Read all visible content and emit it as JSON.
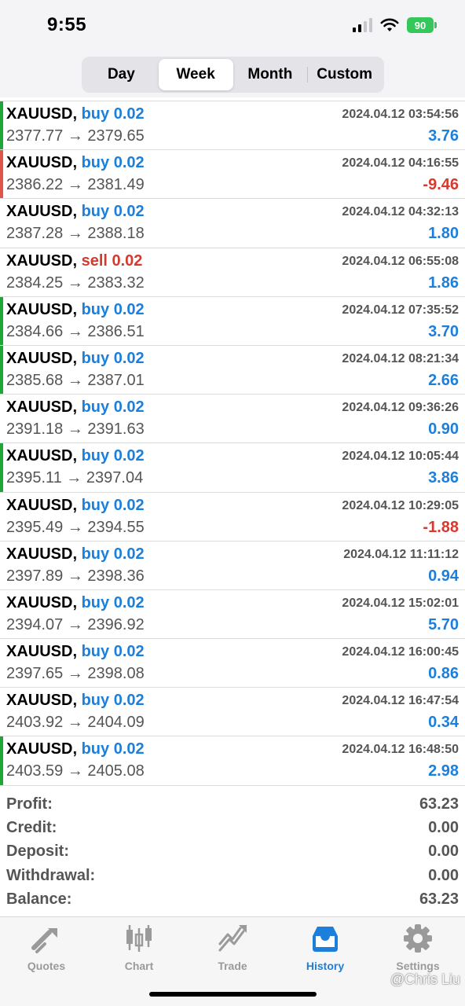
{
  "status_bar": {
    "time": "9:55",
    "battery": "90"
  },
  "period_tabs": [
    {
      "label": "Day",
      "active": false
    },
    {
      "label": "Week",
      "active": true
    },
    {
      "label": "Month",
      "active": false
    },
    {
      "label": "Custom",
      "active": false
    }
  ],
  "trades": [
    {
      "symbol": "XAUUSD,",
      "side": "buy 0.02",
      "type": "buy",
      "time": "2024.04.12 03:54:56",
      "prices": "2377.77 → 2379.65",
      "profit": "3.76",
      "marker": "#1fa637"
    },
    {
      "symbol": "XAUUSD,",
      "side": "buy 0.02",
      "type": "buy",
      "time": "2024.04.12 04:16:55",
      "prices": "2386.22 → 2381.49",
      "profit": "-9.46",
      "marker": "#e0554a"
    },
    {
      "symbol": "XAUUSD,",
      "side": "buy 0.02",
      "type": "buy",
      "time": "2024.04.12 04:32:13",
      "prices": "2387.28 → 2388.18",
      "profit": "1.80",
      "marker": ""
    },
    {
      "symbol": "XAUUSD,",
      "side": "sell 0.02",
      "type": "sell",
      "time": "2024.04.12 06:55:08",
      "prices": "2384.25 → 2383.32",
      "profit": "1.86",
      "marker": ""
    },
    {
      "symbol": "XAUUSD,",
      "side": "buy 0.02",
      "type": "buy",
      "time": "2024.04.12 07:35:52",
      "prices": "2384.66 → 2386.51",
      "profit": "3.70",
      "marker": "#1fa637"
    },
    {
      "symbol": "XAUUSD,",
      "side": "buy 0.02",
      "type": "buy",
      "time": "2024.04.12 08:21:34",
      "prices": "2385.68 → 2387.01",
      "profit": "2.66",
      "marker": "#1fa637"
    },
    {
      "symbol": "XAUUSD,",
      "side": "buy 0.02",
      "type": "buy",
      "time": "2024.04.12 09:36:26",
      "prices": "2391.18 → 2391.63",
      "profit": "0.90",
      "marker": ""
    },
    {
      "symbol": "XAUUSD,",
      "side": "buy 0.02",
      "type": "buy",
      "time": "2024.04.12 10:05:44",
      "prices": "2395.11 → 2397.04",
      "profit": "3.86",
      "marker": "#1fa637"
    },
    {
      "symbol": "XAUUSD,",
      "side": "buy 0.02",
      "type": "buy",
      "time": "2024.04.12 10:29:05",
      "prices": "2395.49 → 2394.55",
      "profit": "-1.88",
      "marker": ""
    },
    {
      "symbol": "XAUUSD,",
      "side": "buy 0.02",
      "type": "buy",
      "time": "2024.04.12 11:11:12",
      "prices": "2397.89 → 2398.36",
      "profit": "0.94",
      "marker": ""
    },
    {
      "symbol": "XAUUSD,",
      "side": "buy 0.02",
      "type": "buy",
      "time": "2024.04.12 15:02:01",
      "prices": "2394.07 → 2396.92",
      "profit": "5.70",
      "marker": ""
    },
    {
      "symbol": "XAUUSD,",
      "side": "buy 0.02",
      "type": "buy",
      "time": "2024.04.12 16:00:45",
      "prices": "2397.65 → 2398.08",
      "profit": "0.86",
      "marker": ""
    },
    {
      "symbol": "XAUUSD,",
      "side": "buy 0.02",
      "type": "buy",
      "time": "2024.04.12 16:47:54",
      "prices": "2403.92 → 2404.09",
      "profit": "0.34",
      "marker": ""
    },
    {
      "symbol": "XAUUSD,",
      "side": "buy 0.02",
      "type": "buy",
      "time": "2024.04.12 16:48:50",
      "prices": "2403.59 → 2405.08",
      "profit": "2.98",
      "marker": "#1fa637"
    }
  ],
  "summary": [
    {
      "label": "Profit:",
      "value": "63.23"
    },
    {
      "label": "Credit:",
      "value": "0.00"
    },
    {
      "label": "Deposit:",
      "value": "0.00"
    },
    {
      "label": "Withdrawal:",
      "value": "0.00"
    },
    {
      "label": "Balance:",
      "value": "63.23"
    }
  ],
  "tab_bar": [
    {
      "label": "Quotes",
      "icon": "quotes-icon",
      "active": false
    },
    {
      "label": "Chart",
      "icon": "chart-icon",
      "active": false
    },
    {
      "label": "Trade",
      "icon": "trade-icon",
      "active": false
    },
    {
      "label": "History",
      "icon": "history-icon",
      "active": true
    },
    {
      "label": "Settings",
      "icon": "settings-icon",
      "active": false
    }
  ],
  "watermark": "@Chris Liu",
  "colors": {
    "buy": "#1c7fdc",
    "sell": "#d63a2f",
    "profit_up": "#1fa637",
    "loss_marker": "#e0554a",
    "inactive": "#9a9a9a"
  }
}
